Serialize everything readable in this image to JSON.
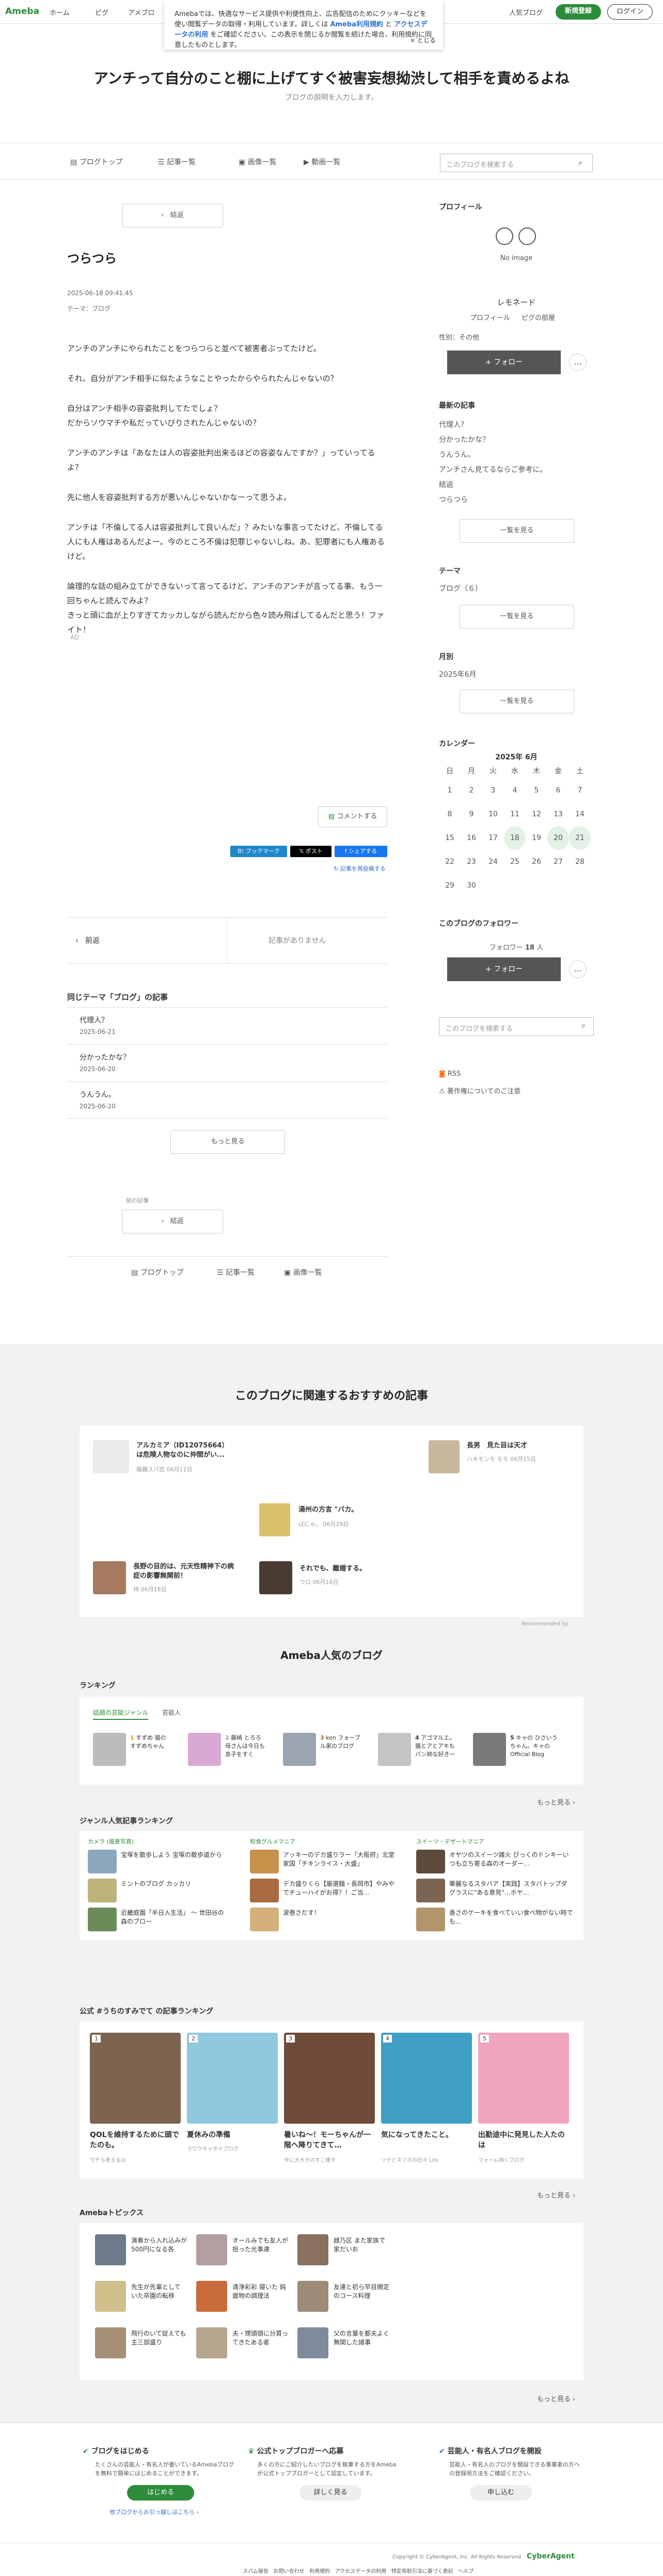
{
  "header": {
    "logo": "Ameba",
    "nav": [
      "ホーム",
      "ピグ",
      "アメブロ"
    ],
    "popular": "人気ブログ",
    "signup": "新規登録",
    "login": "ログイン"
  },
  "cookie": {
    "text1": "Amebaでは、快適なサービス提供や利便性向上、広告配信のためにクッキーなどを使い閲覧データの取得・利用しています。詳しくは ",
    "link1": "Ameba利用規約",
    "mid": " と ",
    "link2": "アクセスデータの利用",
    "text2": " をご確認ください。この表示を閉じるか閲覧を続けた場合、利用規約に同意したものとします。",
    "close": "× とじる"
  },
  "blog": {
    "title": "アンチって自分のこと棚に上げてすぐ被害妄想拗渋して相手を責めるよね",
    "desc": "ブログの説明を入力します。"
  },
  "gnav": {
    "items": [
      "ブログトップ",
      "記事一覧",
      "画像一覧",
      "動画一覧"
    ],
    "search_placeholder": "このブログを検索する"
  },
  "article": {
    "back": "結返",
    "title": "つらつら",
    "date": "2025-06-18 09:41:45",
    "theme": "テーマ：ブログ",
    "paras": [
      "アンチのアンチにやられたことをつらつらと並べて被害者ぶってたけど。",
      "それ、自分がアンチ相手に似たようなことやったからやられたんじゃないの？",
      "自分はアンチ相手の容姿批判してたでしょ？\nだからソウマチや私だっていびりされたんじゃないの？",
      "アンチのアンチは「あなたは人の容姿批判出来るほどの容姿なんですか？」っていってるよ？",
      "先に他人を容姿批判する方が悪いんじゃないかなーって思うよ。",
      "アンチは「不倫してる人は容姿批判して良いんだ」？みたいな事言ってたけど、不倫してる人にも人権はあるんだよー。今のところ不倫は犯罪じゃないしね。あ、犯罪者にも人権あるけど。",
      "論理的な話の組み立てができないって言ってるけど、アンチのアンチが言ってる事、もう一回ちゃんと読んでみよ？\nきっと頭に血が上りすぎてカッカしながら読んだから色々読み飛ばしてるんだと思う！ファイト！"
    ],
    "ad": "AD",
    "comment": "コメントする",
    "share_x": "ポスト",
    "share_hb": "ブックマーク",
    "share_fb": "シェアする",
    "reblog": "記事を再投稿する",
    "prev": "前返",
    "next": "記事がありません",
    "same_theme_h": "同じテーマ「ブログ」の記事",
    "related": [
      {
        "title": "代理人？",
        "date": "2025-06-21"
      },
      {
        "title": "分かったかな？",
        "date": "2025-06-20"
      },
      {
        "title": "うんうん。",
        "date": "2025-06-20"
      }
    ],
    "more": "もっと見る",
    "prev_label": "前の記事",
    "prev_btn": "結返",
    "bottom_nav": [
      "ブログトップ",
      "記事一覧",
      "画像一覧"
    ]
  },
  "sidebar": {
    "profile_h": "プロフィール",
    "avatar_text": "No image",
    "name": "レモネード",
    "links": [
      "プロフィール",
      "ピグの部屋"
    ],
    "gender": "性別：その他",
    "follow": "+ フォロー",
    "recent_h": "最新の記事",
    "recent": [
      "代理人？",
      "分かったかな？",
      "うんうん。",
      "アンチさん見てるならご参考に。",
      "結返",
      "つらつら"
    ],
    "list_btn": "一覧を見る",
    "theme_h": "テーマ",
    "themes": [
      "ブログ（６）"
    ],
    "month_h": "月別",
    "months": [
      "2025年6月"
    ],
    "cal_h": "カレンダー",
    "cal_title": "2025年 6月",
    "cal_days": [
      "日",
      "月",
      "火",
      "水",
      "木",
      "金",
      "土"
    ],
    "cal": [
      [
        "1",
        "2",
        "3",
        "4",
        "5",
        "6",
        "7"
      ],
      [
        "8",
        "9",
        "10",
        "11",
        "12",
        "13",
        "14"
      ],
      [
        "15",
        "16",
        "17",
        "18",
        "19",
        "20",
        "21"
      ],
      [
        "22",
        "23",
        "24",
        "25",
        "26",
        "27",
        "28"
      ],
      [
        "29",
        "30",
        "",
        "",
        "",
        "",
        ""
      ]
    ],
    "followers_h": "このブログのフォロワー",
    "followers": "フォロワー",
    "followers_count": "18",
    "followers_unit": "人",
    "search_placeholder": "このブログを検索する",
    "rss": "RSS",
    "report": "著作権についてのご注意"
  },
  "rec": {
    "h": "このブログに関連するおすすめの記事",
    "items": [
      {
        "title": "アルカミア（ID12075664）は危険人物なのに仲間がい...",
        "meta": "藤鵬スパ恋 06月11日"
      },
      {
        "title": "長男　見た目は天才",
        "meta": "ハキモンモ モモ 06月15日"
      },
      {
        "title": "湯州の方言 \"バカ。",
        "meta": "ぽにゃ。 06月29日"
      },
      {
        "title": "長野の目的は、元天性精神下の病症の影響無関前！",
        "meta": "待 06月18日"
      },
      {
        "title": "それでも、離婚する。",
        "meta": "ウロ 06月16日"
      }
    ],
    "credit": "Recommended by"
  },
  "popular": {
    "h": "Ameba人気のブログ",
    "rank_h": "ランキング",
    "tabs": [
      "話題の芸能ジャンル",
      "芸能人"
    ],
    "rank": [
      {
        "n": "1",
        "t": "すずめ 猫のすずめちゃん"
      },
      {
        "n": "2",
        "t": "藤崎 とろろ 母さんは今日も息子をすく"
      },
      {
        "n": "3",
        "t": "ken フォーブル家のブログ"
      },
      {
        "n": "4",
        "t": "アゴマルエ。 猫とアとアキもパン姉な好きー"
      },
      {
        "n": "5",
        "t": "キャの ひさいうちゃん。キャの Official Blog"
      }
    ],
    "more": "もっと見る",
    "genre_h": "ジャンル人気記事ランキング",
    "cols": [
      {
        "h": "カメラ (風景写真)",
        "items": [
          "宝塚を散歩しよう 宝塚の散歩道から",
          "ミントのブログ カッカリ",
          "近畿庭園「半日入生活」 ～ 世田谷の森のブロー"
        ]
      },
      {
        "h": "和食グルメマニア",
        "items": [
          "アッキーのデカ盛りラー「大阪府」北堂家国「チキンライス・大盛」",
          "デカ盛りくら【厳選麺・長岡市】やみやでチューハイがお得？！ご当…",
          "波巻さだす！"
        ]
      },
      {
        "h": "スイーツ・デザートマニア",
        "items": [
          "オヤツのスイーツ雑火 ぴっくのドンキーいつも立ち寄る森のオーダー…",
          "華麗なるスタバア【実践】スタバトップダグラスに\"ある意見\"…ホヤ…",
          "香さのケーキを食べていい食べ物がない時でも…"
        ]
      }
    ],
    "official_h": "公式 #うちのすみでて の記事ランキング",
    "official": [
      {
        "n": "1",
        "t": "QOLを維持するために頭でたのも。",
        "m": "ウチら考えるは"
      },
      {
        "n": "2",
        "t": "夏休みの準備",
        "m": "ラワウキャホイブログ"
      },
      {
        "n": "3",
        "t": "暑いね～！モーちゃんが一階へ降りてきて…",
        "m": "今に大き子のすこ様子"
      },
      {
        "n": "4",
        "t": "気になってきたこと。",
        "m": "ソデとネフホの日々 Life"
      },
      {
        "n": "5",
        "t": "出勤途中に発見した人たのは",
        "m": "フォーム掃くブログ"
      }
    ],
    "topics_h": "Amebaトピックス",
    "topics": [
      [
        "演奏から入れ込みが500円になる各",
        "オールみでも友人が担った光事達",
        "雌乃区 また家族で家だいお"
      ],
      [
        "先生が先輩として いた卒園の転移",
        "清浄彩彩 寝いた 鈍面物の調理法",
        "友達と初ら早目開定のコース料理"
      ],
      [
        "飛行のいて捉えても主三部盛り",
        "夫・甥頭頭に分買ってきたある者",
        "父の言葉を都夫よく無関した諸事"
      ]
    ],
    "topics_more": "もっと見る"
  },
  "promo": [
    {
      "h": "ブログをはじめる",
      "d": "たくさんの芸能人・有名人が書いているAmebaブログを無料で簡単にはじめることができます。",
      "b": "はじめる",
      "sub": "他ブログからお引っ越しはこちら"
    },
    {
      "h": "公式トップブロガーへ応募",
      "d": "多くの方にご紹介したいブログを執筆する方をAmebaが公式トップブロガーとして認定しています。",
      "b": "詳しく見る"
    },
    {
      "h": "芸能人・有名人ブログを開設",
      "d": "芸能人・有名人のブログを開設できる事業者の方への登録用方法をご確認ください。",
      "b": "申し込む"
    }
  ],
  "footer": {
    "copyright": "Copyright © CyberAgent, Inc. All Rights Reserved.",
    "brand": "CyberAgent",
    "links": [
      "スパム報告",
      "お問い合わせ",
      "利用規約",
      "アクセスデータの利用",
      "特定商取引法に基づく表記",
      "ヘルプ"
    ]
  },
  "colors": {
    "green": "#2d8c3c",
    "accent": "#1e9e4a"
  }
}
